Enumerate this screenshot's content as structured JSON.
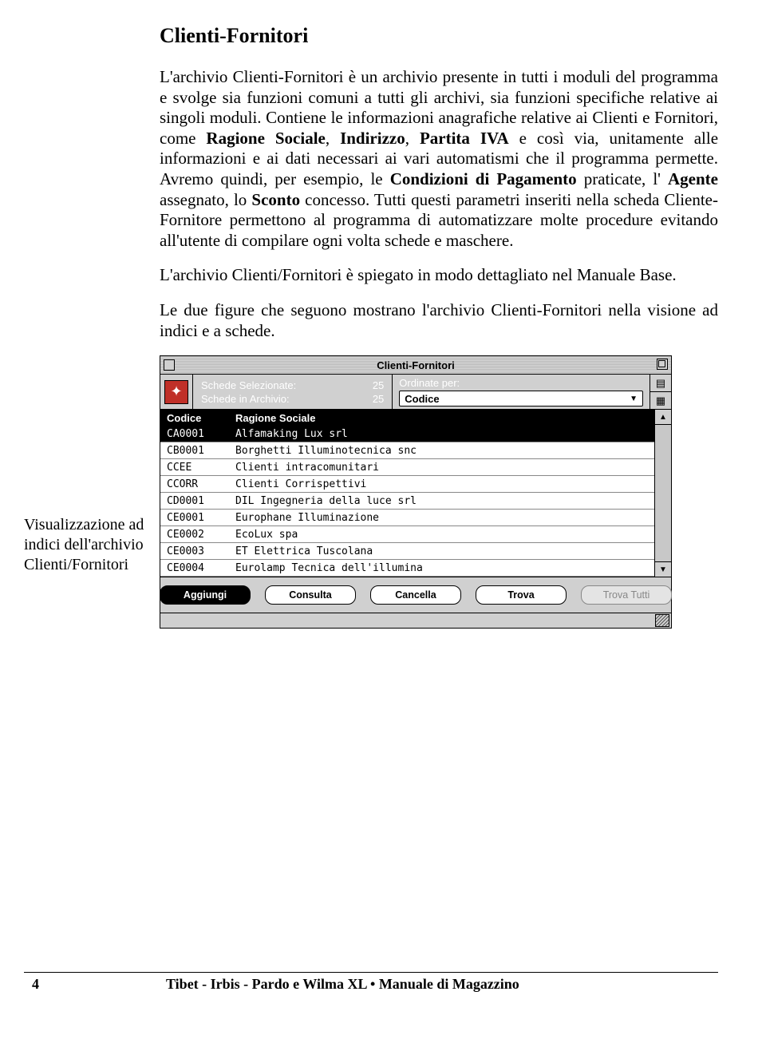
{
  "title": "Clienti-Fornitori",
  "para1_a": "L'archivio Clienti-Fornitori è un archivio presente in tutti i moduli del programma e svolge sia funzioni comuni a tutti gli archivi, sia funzioni specifiche relative ai singoli moduli. Contiene le informazioni anagrafiche relative ai Clienti e Fornitori, come ",
  "b1": "Ragione Sociale",
  "s1": ", ",
  "b2": "Indirizzo",
  "s2": ", ",
  "b3": "Partita IVA",
  "para1_b": " e così via, unitamente alle informazioni e ai dati necessari ai vari automatismi che il programma permette. Avremo quindi, per esempio, le ",
  "b4": "Condizioni di Pagamento",
  "s3": " praticate, l'",
  "b5": "Agente",
  "s4": " assegnato, lo ",
  "b6": "Sconto",
  "para1_c": " concesso. Tutti questi parametri inseriti nella scheda Cliente-Fornitore permettono al programma di automatizzare molte procedure evitando all'utente di compilare ogni volta schede e maschere.",
  "para2": "L'archivio Clienti/Fornitori è spiegato in modo dettagliato nel Manuale Base.",
  "para3": "Le due figure che seguono mostrano l'archivio Clienti-Fornitori nella visione ad indici e a schede.",
  "sidebar_caption": "Visualizzazione ad indici dell'archivio Clienti/Fornitori",
  "app": {
    "window_title": "Clienti-Fornitori",
    "schede_selezionate_label": "Schede Selezionate:",
    "schede_selezionate_value": "25",
    "schede_archivio_label": "Schede in Archivio:",
    "schede_archivio_value": "25",
    "ordinate_label": "Ordinate per:",
    "sort_value": "Codice",
    "col_code": "Codice",
    "col_name": "Ragione Sociale",
    "rows": [
      {
        "code": "CA0001",
        "name": "Alfamaking Lux srl",
        "selected": true
      },
      {
        "code": "CB0001",
        "name": "Borghetti Illuminotecnica snc",
        "selected": false
      },
      {
        "code": "CCEE",
        "name": "Clienti intracomunitari",
        "selected": false
      },
      {
        "code": "CCORR",
        "name": "Clienti Corrispettivi",
        "selected": false
      },
      {
        "code": "CD0001",
        "name": "DIL Ingegneria della luce srl",
        "selected": false
      },
      {
        "code": "CE0001",
        "name": "Europhane Illuminazione",
        "selected": false
      },
      {
        "code": "CE0002",
        "name": "EcoLux spa",
        "selected": false
      },
      {
        "code": "CE0003",
        "name": "ET Elettrica Tuscolana",
        "selected": false
      },
      {
        "code": "CE0004",
        "name": "Eurolamp Tecnica dell'illumina",
        "selected": false
      }
    ],
    "buttons": {
      "aggiungi": "Aggiungi",
      "consulta": "Consulta",
      "cancella": "Cancella",
      "trova": "Trova",
      "trova_tutti": "Trova Tutti"
    }
  },
  "footer": {
    "page": "4",
    "text": "Tibet - Irbis - Pardo e Wilma XL • Manuale di Magazzino"
  }
}
